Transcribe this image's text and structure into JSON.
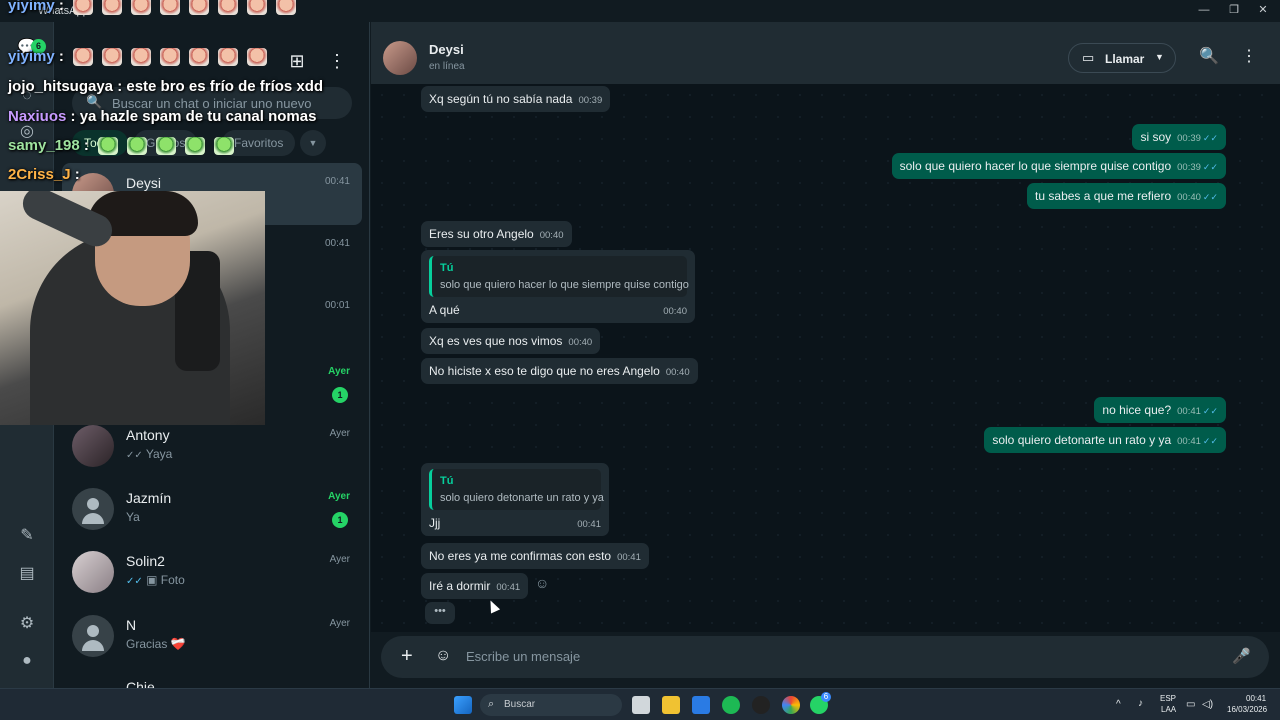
{
  "window": {
    "title": "WhatsApp",
    "min": "—",
    "max": "❐",
    "close": "✕"
  },
  "rail": {
    "unread_count": "6"
  },
  "search": {
    "placeholder": "Buscar un chat o iniciar uno nuevo"
  },
  "filters": {
    "all": "Todos",
    "groups": "Grupos",
    "favorites": "Favoritos"
  },
  "chats": [
    {
      "name": "Deysi",
      "preview": "",
      "time": "00:41",
      "unread": "",
      "selected": true
    },
    {
      "name": "",
      "preview": "",
      "time": "00:41",
      "unread": ""
    },
    {
      "name": "",
      "preview": "",
      "time": "00:01",
      "unread": ""
    },
    {
      "name": "",
      "preview": "",
      "time": "Ayer",
      "unread": "1"
    },
    {
      "name": "Antony",
      "preview": "Yaya",
      "time": "Ayer",
      "unread": ""
    },
    {
      "name": "Jazmín",
      "preview": "Ya",
      "time": "Ayer",
      "unread": "1"
    },
    {
      "name": "Solin2",
      "preview": "Foto",
      "time": "Ayer",
      "unread": ""
    },
    {
      "name": "N",
      "preview": "Gracias ❤️‍🩹",
      "time": "Ayer",
      "unread": ""
    },
    {
      "name": "Chie",
      "preview": "",
      "time": "",
      "unread": ""
    }
  ],
  "chat": {
    "contact_name": "Deysi",
    "status": "en línea",
    "call_label": "Llamar",
    "messages": [
      {
        "dir": "in",
        "text": "Xq según tú no sabía nada",
        "time": "00:39"
      },
      {
        "dir": "out",
        "text": "si soy",
        "time": "00:39"
      },
      {
        "dir": "out",
        "text": "solo que quiero hacer lo que siempre quise contigo",
        "time": "00:39"
      },
      {
        "dir": "out",
        "text": "tu sabes a que me refiero",
        "time": "00:40"
      },
      {
        "dir": "in",
        "text": "Eres su otro Angelo",
        "time": "00:40"
      },
      {
        "dir": "in",
        "quote_name": "Tú",
        "quote_text": "solo que quiero hacer lo que siempre quise contigo",
        "text": "A qué",
        "time": "00:40"
      },
      {
        "dir": "in",
        "text": "Xq es ves que nos vimos",
        "time": "00:40"
      },
      {
        "dir": "in",
        "text": "No hiciste x eso te digo que no eres Angelo",
        "time": "00:40"
      },
      {
        "dir": "out",
        "text": "no hice que?",
        "time": "00:41"
      },
      {
        "dir": "out",
        "text": "solo quiero detonarte un rato y ya",
        "time": "00:41"
      },
      {
        "dir": "in",
        "quote_name": "Tú",
        "quote_text": "solo quiero detonarte un rato y ya",
        "text": "Jjj",
        "time": "00:41"
      },
      {
        "dir": "in",
        "text": "No eres ya me confirmas con esto",
        "time": "00:41"
      },
      {
        "dir": "in",
        "text": "Iré a dormir",
        "time": "00:41"
      }
    ],
    "composer_placeholder": "Escribe un mensaje"
  },
  "taskbar": {
    "search_label": "Buscar",
    "lang": "ESP",
    "layout": "LAA",
    "time": "00:41",
    "date": "16/03/2026",
    "whatsapp_badge": "6"
  },
  "overlay": {
    "lines": [
      {
        "user": "yiyimy",
        "text": ":",
        "color": "#7fb2ff"
      },
      {
        "user": "yiyimy",
        "text": ":",
        "color": "#7fb2ff"
      },
      {
        "user": "jojo_hitsugaya",
        "text": ": este bro es frío de fríos xdd",
        "color": "#ffffff"
      },
      {
        "user": "Naxiuos",
        "text": ": ya hazle spam de tu canal nomas",
        "color": "#c79bff"
      },
      {
        "user": "samy_198",
        "text": ":",
        "color": "#9fe39f"
      },
      {
        "user": "2Criss_J",
        "text": ":",
        "color": "#ffb347"
      }
    ]
  }
}
